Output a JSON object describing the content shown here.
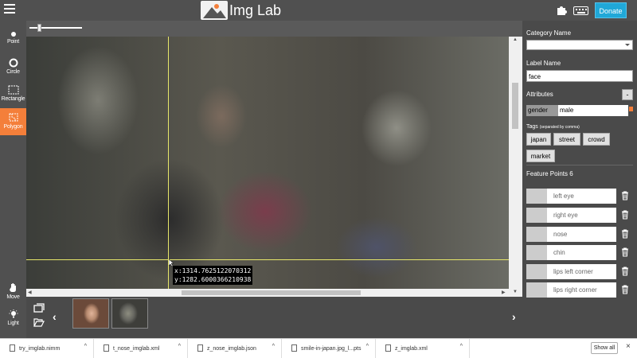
{
  "header": {
    "app_title": "Img Lab",
    "donate_label": "Donate",
    "icons": [
      "hamburger-icon",
      "logo-icon",
      "puzzle-icon",
      "keyboard-icon"
    ]
  },
  "toolbar": {
    "tools": [
      {
        "label": "Point",
        "icon": "point-icon",
        "active": false
      },
      {
        "label": "Circle",
        "icon": "circle-icon",
        "active": false
      },
      {
        "label": "Rectangle",
        "icon": "rectangle-icon",
        "active": false
      },
      {
        "label": "Polygon",
        "icon": "polygon-icon",
        "active": true
      }
    ],
    "bottom_tools": [
      {
        "label": "Move",
        "icon": "move-icon"
      },
      {
        "label": "Light",
        "icon": "light-icon"
      }
    ],
    "active_color": "#f47f3a"
  },
  "canvas": {
    "coord_x": "x:1314.7625122070312",
    "coord_y": "y:1282.6000366210938",
    "crosshair_color": "#e7e76a"
  },
  "panel": {
    "category_label": "Category Name",
    "category_value": "",
    "label_name_label": "Label Name",
    "label_name_value": "face",
    "attributes_label": "Attributes",
    "attribute_toggle": "-",
    "attribute_key": "gender",
    "attribute_value": "male",
    "tags_label": "Tags",
    "tags_hint": "(separated by comma)",
    "tags": [
      "japan",
      "street",
      "crowd",
      "market"
    ],
    "feature_points_label": "Feature Points",
    "feature_points_count": "6",
    "feature_points": [
      "left eye",
      "right eye",
      "nose",
      "chin",
      "lips left corner",
      "lips right corner"
    ]
  },
  "downloads": {
    "items": [
      "try_imglab.nimm",
      "t_nose_imglab.xml",
      "z_nose_imglab.json",
      "smile-in-japan.jpg_l...pts",
      "z_imglab.xml"
    ],
    "show_all_label": "Show all",
    "close_label": "×"
  },
  "colors": {
    "accent": "#f47f3a",
    "donate": "#20a8d8",
    "background": "#4a4a4a"
  }
}
